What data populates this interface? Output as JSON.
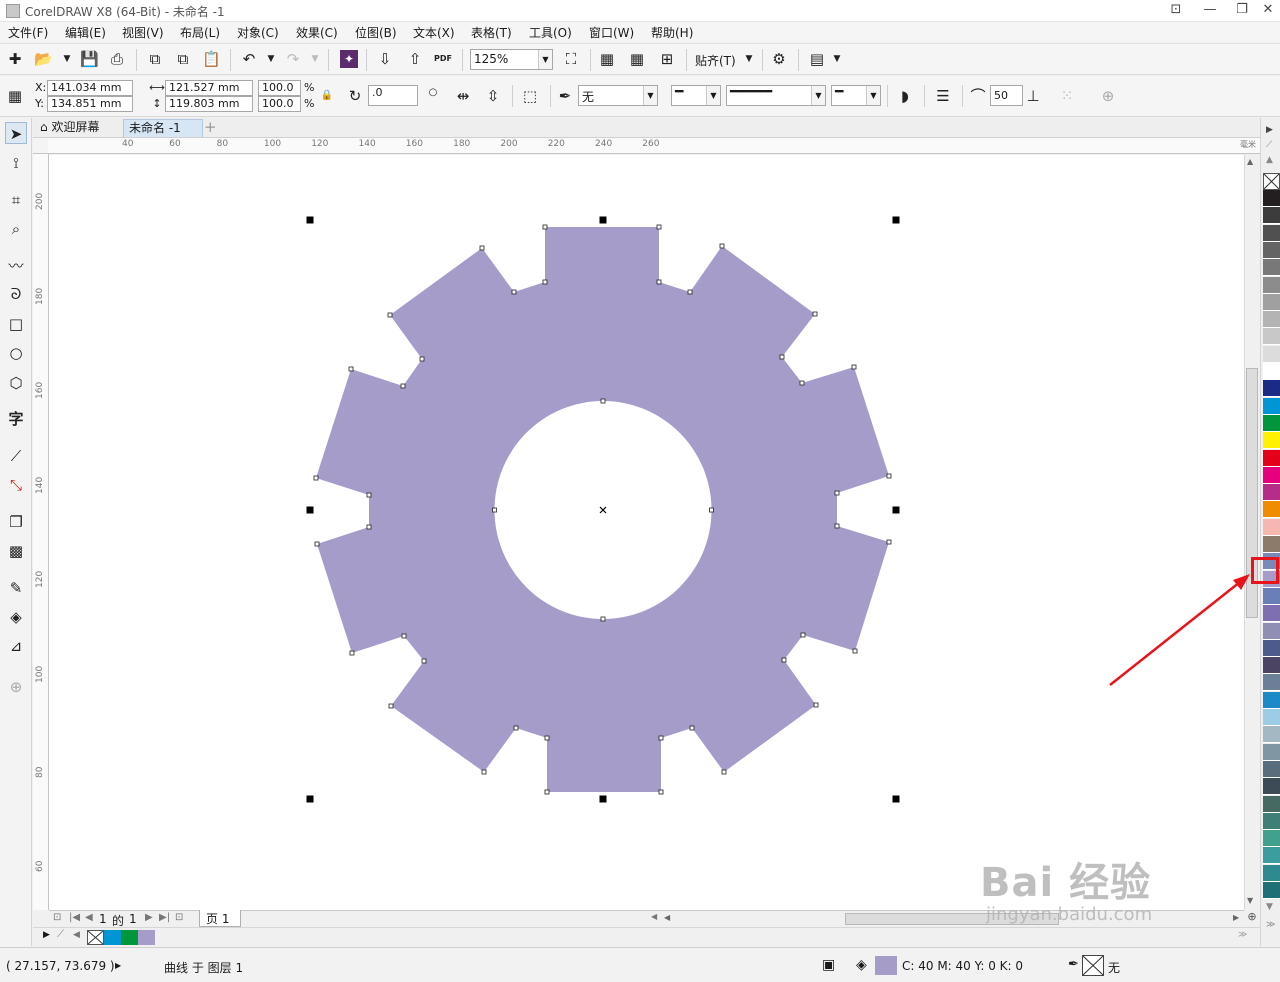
{
  "window": {
    "title": "CorelDRAW X8 (64-Bit) - 未命名 -1"
  },
  "menu": [
    "文件(F)",
    "编辑(E)",
    "视图(V)",
    "布局(L)",
    "对象(C)",
    "效果(C)",
    "位图(B)",
    "文本(X)",
    "表格(T)",
    "工具(O)",
    "窗口(W)",
    "帮助(H)"
  ],
  "toolbar": {
    "zoom_value": "125%",
    "snap_label": "贴齐(T)",
    "pdf_label": "PDF"
  },
  "properties": {
    "x_label": "X:",
    "y_label": "Y:",
    "x_value": "141.034 mm",
    "y_value": "134.851 mm",
    "width_value": "121.527 mm",
    "height_value": "119.803 mm",
    "scale_w": "100.0",
    "scale_h": "100.0",
    "percent": "%",
    "rotation": ".0",
    "outline_width": "无",
    "smoothing": "50"
  },
  "tabs": {
    "welcome": "欢迎屏幕",
    "document": "未命名 -1"
  },
  "ruler": {
    "horizontal": [
      "40",
      "60",
      "80",
      "100",
      "120",
      "140",
      "160",
      "180",
      "200",
      "220",
      "240",
      "260"
    ],
    "vertical": [
      "200",
      "180",
      "160",
      "140",
      "120",
      "100",
      "80",
      "60"
    ],
    "unit_label": "毫米"
  },
  "page_nav": {
    "current": "1",
    "of_label": "的",
    "total": "1",
    "page_tab": "页 1"
  },
  "palette_colors": [
    "#231f20",
    "#3c3c3c",
    "#505050",
    "#646464",
    "#787878",
    "#8c8c8c",
    "#a0a0a0",
    "#b4b4b4",
    "#c8c8c8",
    "#dcdcdc",
    "#ffffff",
    "#1b2a85",
    "#0096d6",
    "#00963c",
    "#fff200",
    "#e2001a",
    "#e6007e",
    "#b52d86",
    "#f08c00",
    "#f4b8b0",
    "#8c7b6b",
    "#7b89b8",
    "#a59cca",
    "#6a7fb5",
    "#7e6fb0",
    "#8f8fb6",
    "#4c5b8a",
    "#4b4462",
    "#6c7f99",
    "#1d8ac8",
    "#9ccce6",
    "#a4b8c4",
    "#7f96a5",
    "#596e7c",
    "#3c4b56",
    "#466a61",
    "#3e7f77",
    "#42a08f",
    "#3b9d9d",
    "#2e8a8f",
    "#1f6f77"
  ],
  "doc_palette": [
    "#0096d6",
    "#00963c",
    "#a59cca"
  ],
  "status": {
    "coords": "( 27.157, 73.679 )",
    "object_info": "曲线 于 图层 1",
    "fill_cmyk": "C: 40 M: 40 Y: 0 K: 0",
    "outline": "无"
  },
  "shape": {
    "fill_color": "#a59cca"
  },
  "watermark": {
    "main": "Bai 经验",
    "sub": "jingyan.baidu.com"
  }
}
